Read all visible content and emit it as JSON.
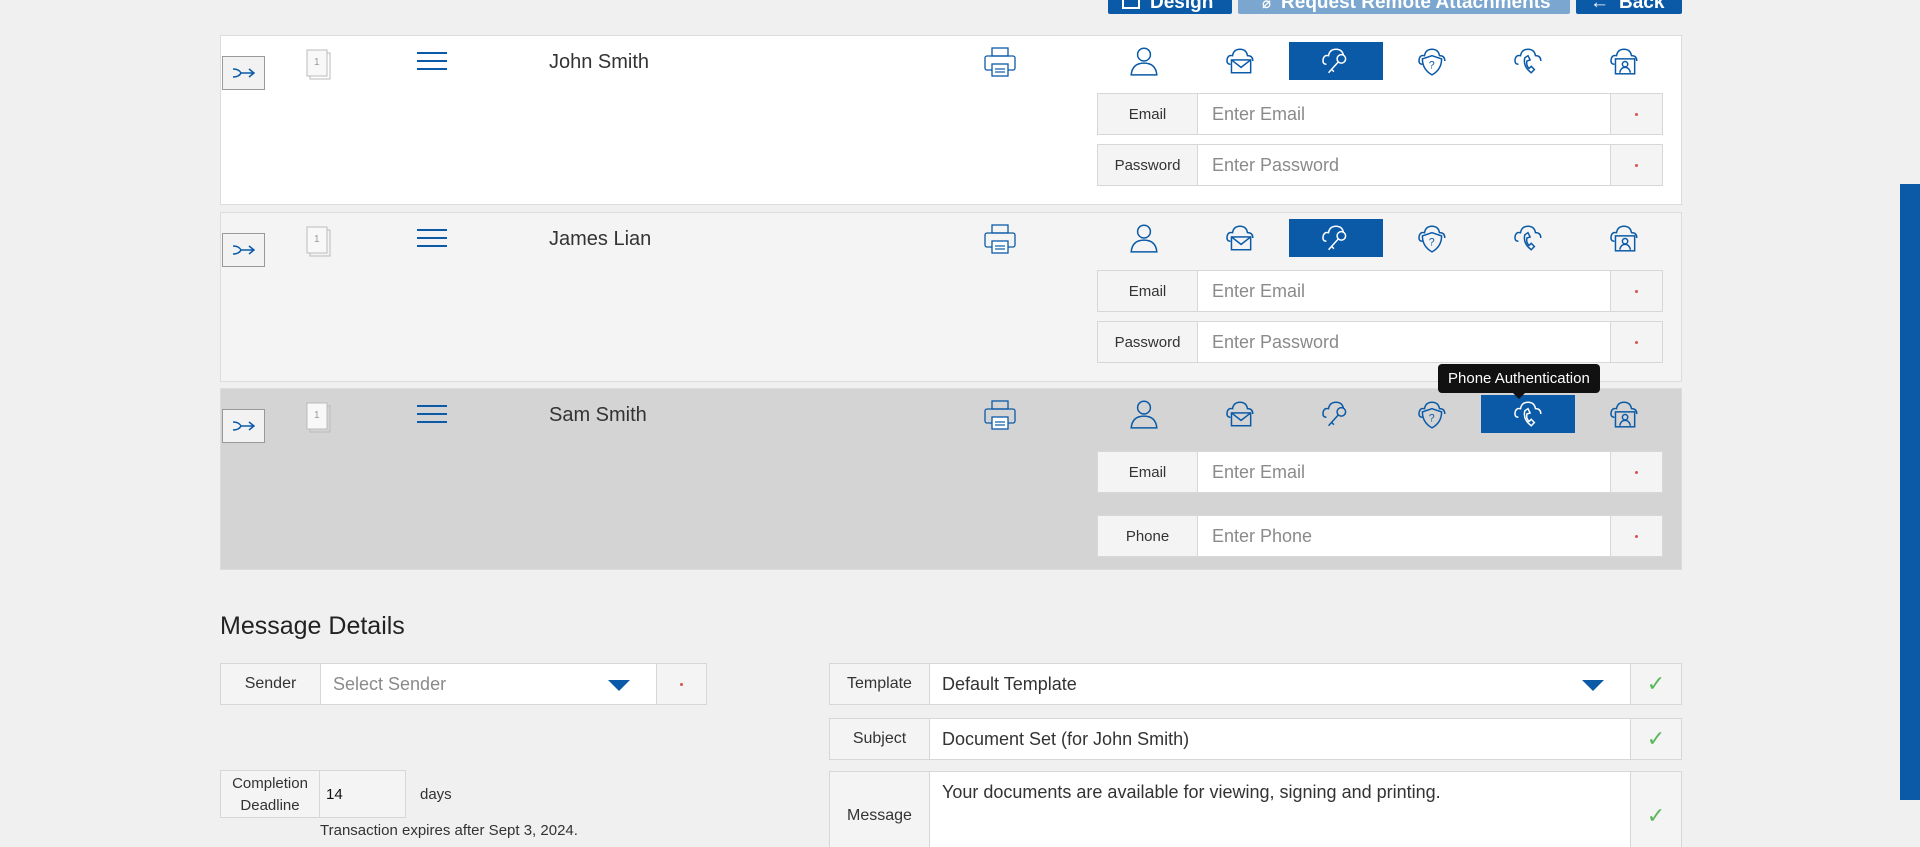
{
  "toolbar": {
    "design_label": "Design",
    "request_label": "Request Remote Attachments",
    "back_label": "Back"
  },
  "recipients": [
    {
      "name": "John Smith",
      "fields": [
        {
          "label": "Email",
          "placeholder": "Enter Email"
        },
        {
          "label": "Password",
          "placeholder": "Enter Password"
        }
      ],
      "active_auth": "password-auth"
    },
    {
      "name": "James Lian",
      "fields": [
        {
          "label": "Email",
          "placeholder": "Enter Email"
        },
        {
          "label": "Password",
          "placeholder": "Enter Password"
        }
      ],
      "active_auth": "password-auth"
    },
    {
      "name": "Sam Smith",
      "fields": [
        {
          "label": "Email",
          "placeholder": "Enter Email"
        },
        {
          "label": "Phone",
          "placeholder": "Enter Phone"
        }
      ],
      "active_auth": "phone-auth"
    }
  ],
  "doc_count": "1",
  "auth_icons": [
    "person-icon",
    "cloud-mail-icon",
    "key-icon",
    "shield-question-icon",
    "phone-icon",
    "cloud-id-icon"
  ],
  "tooltip": "Phone Authentication",
  "message_details": {
    "title": "Message Details",
    "sender_label": "Sender",
    "sender_placeholder": "Select Sender",
    "template_label": "Template",
    "template_value": "Default Template",
    "subject_label": "Subject",
    "subject_value": "Document Set (for John Smith)",
    "message_label": "Message",
    "message_value": "Your documents are available for viewing, signing and printing.",
    "deadline_label": "Completion Deadline",
    "deadline_value": "14",
    "deadline_unit": "days",
    "expires_text": "Transaction expires after Sept 3, 2024."
  },
  "colors": {
    "accent": "#0a5aa8",
    "check": "#5cb85c",
    "required": "#d9534f"
  }
}
